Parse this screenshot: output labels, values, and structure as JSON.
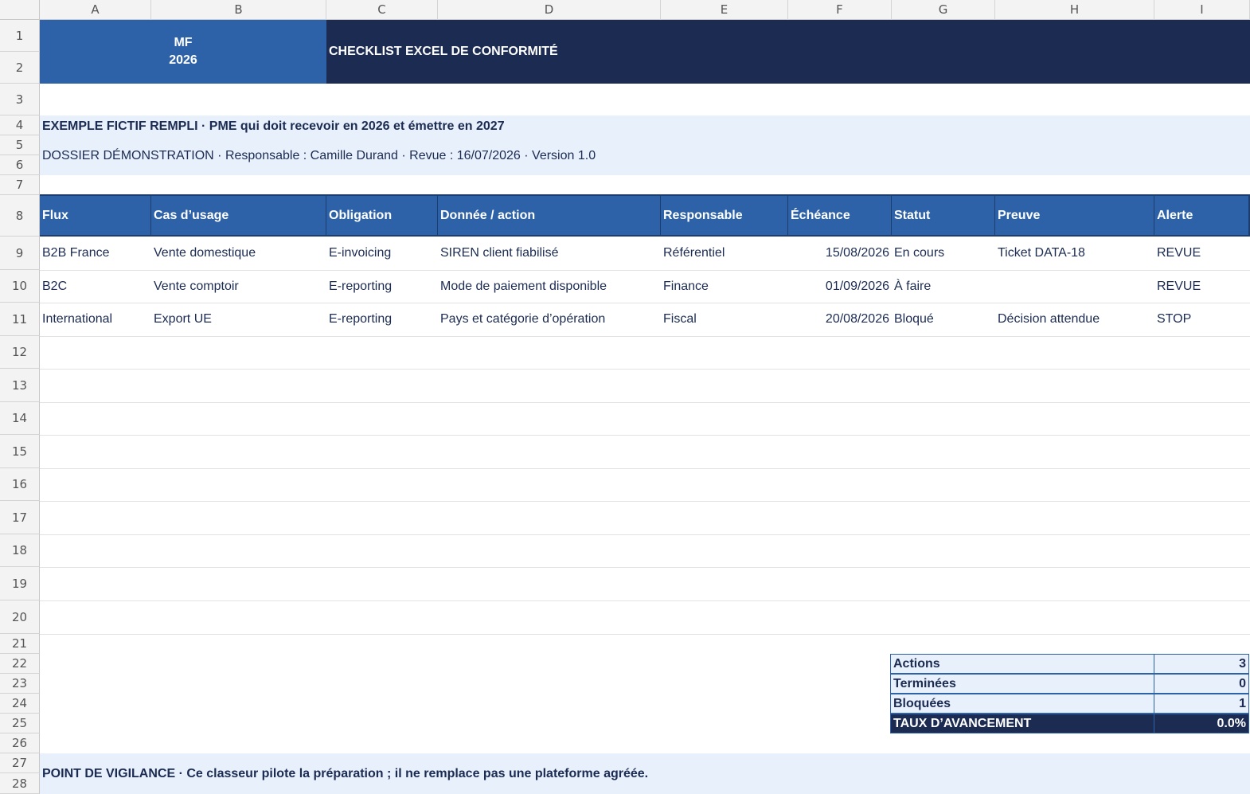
{
  "columns": [
    "A",
    "B",
    "C",
    "D",
    "E",
    "F",
    "G",
    "H",
    "I"
  ],
  "rows": [
    "1",
    "2",
    "3",
    "4",
    "5",
    "6",
    "7",
    "8",
    "9",
    "10",
    "11",
    "12",
    "13",
    "14",
    "15",
    "16",
    "17",
    "18",
    "19",
    "20",
    "21",
    "22",
    "23",
    "24",
    "25",
    "26",
    "27",
    "28"
  ],
  "logo": {
    "line1": "MF",
    "line2": "2026"
  },
  "title": "CHECKLIST EXCEL DE CONFORMITÉ",
  "example_line": "EXEMPLE FICTIF REMPLI · PME qui doit recevoir en 2026 et émettre en 2027",
  "dossier_line": "DOSSIER DÉMONSTRATION · Responsable : Camille Durand · Revue : 16/07/2026 · Version 1.0",
  "table": {
    "headers": [
      "Flux",
      "Cas d’usage",
      "Obligation",
      "Donnée / action",
      "Responsable",
      "Échéance",
      "Statut",
      "Preuve",
      "Alerte"
    ],
    "rows": [
      [
        "B2B France",
        "Vente domestique",
        "E-invoicing",
        "SIREN client fiabilisé",
        "Référentiel",
        "15/08/2026",
        "En cours",
        "Ticket DATA-18",
        "REVUE"
      ],
      [
        "B2C",
        "Vente comptoir",
        "E-reporting",
        "Mode de paiement disponible",
        "Finance",
        "01/09/2026",
        "À faire",
        "",
        "REVUE"
      ],
      [
        "International",
        "Export UE",
        "E-reporting",
        "Pays et catégorie d’opération",
        "Fiscal",
        "20/08/2026",
        "Bloqué",
        "Décision attendue",
        "STOP"
      ]
    ]
  },
  "summary": [
    {
      "label": "Actions",
      "value": "3"
    },
    {
      "label": "Terminées",
      "value": "0"
    },
    {
      "label": "Bloquées",
      "value": "1"
    },
    {
      "label": "TAUX D’AVANCEMENT",
      "value": "0.0%"
    }
  ],
  "vigilance": "POINT DE VIGILANCE · Ce classeur pilote la préparation ; il ne remplace pas une plateforme agréée.",
  "colors": {
    "logo_bg": "#2e62a8",
    "title_bg": "#1b2b52",
    "info_band": "#e8f0fb",
    "header_bg": "#2e62a8",
    "text": "#1b2b52"
  }
}
